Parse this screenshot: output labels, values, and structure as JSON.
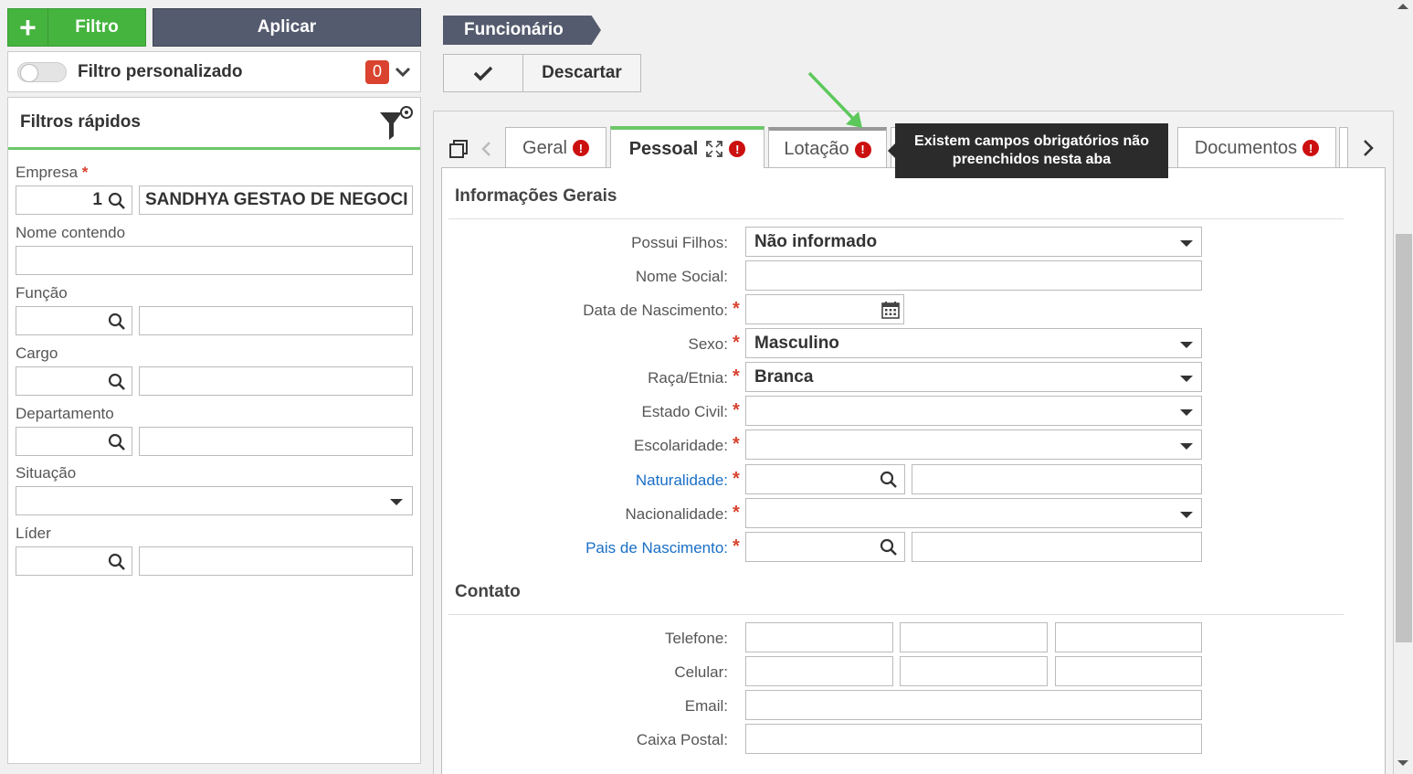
{
  "toolbar_left": {
    "filtro_label": "Filtro",
    "aplicar_label": "Aplicar"
  },
  "custom_filter": {
    "label": "Filtro personalizado",
    "count": "0"
  },
  "quick_filters": {
    "title": "Filtros rápidos",
    "empresa": {
      "label": "Empresa",
      "required": "*",
      "code": "1",
      "name": "SANDHYA GESTAO DE NEGOCIOS"
    },
    "nome_contendo": {
      "label": "Nome contendo"
    },
    "funcao": {
      "label": "Função"
    },
    "cargo": {
      "label": "Cargo"
    },
    "departamento": {
      "label": "Departamento"
    },
    "situacao": {
      "label": "Situação"
    },
    "lider": {
      "label": "Líder"
    }
  },
  "record": {
    "title": "Funcionário",
    "discard_label": "Descartar"
  },
  "tabs": {
    "geral": "Geral",
    "pessoal": "Pessoal",
    "lotacao": "Lotação",
    "documentos": "Documentos",
    "error_mark": "!"
  },
  "tooltip": {
    "text": "Existem campos obrigatórios não preenchidos nesta aba"
  },
  "info_gerais": {
    "title": "Informações Gerais",
    "possui_filhos": {
      "label": "Possui Filhos:",
      "value": "Não informado"
    },
    "nome_social": {
      "label": "Nome Social:"
    },
    "data_nascimento": {
      "label": "Data de Nascimento:"
    },
    "sexo": {
      "label": "Sexo:",
      "value": "Masculino"
    },
    "raca": {
      "label": "Raça/Etnia:",
      "value": "Branca"
    },
    "estado_civil": {
      "label": "Estado Civil:"
    },
    "escolaridade": {
      "label": "Escolaridade:"
    },
    "naturalidade": {
      "label": "Naturalidade:"
    },
    "nacionalidade": {
      "label": "Nacionalidade:"
    },
    "pais_nascimento": {
      "label": "Pais de Nascimento:"
    },
    "required_mark": "*"
  },
  "contato": {
    "title": "Contato",
    "telefone": {
      "label": "Telefone:"
    },
    "celular": {
      "label": "Celular:"
    },
    "email": {
      "label": "Email:"
    },
    "caixa_postal": {
      "label": "Caixa Postal:"
    }
  },
  "colors": {
    "green": "#45b43f",
    "dark": "#555b6e",
    "error": "#cc1010",
    "link": "#1a6fc6"
  }
}
